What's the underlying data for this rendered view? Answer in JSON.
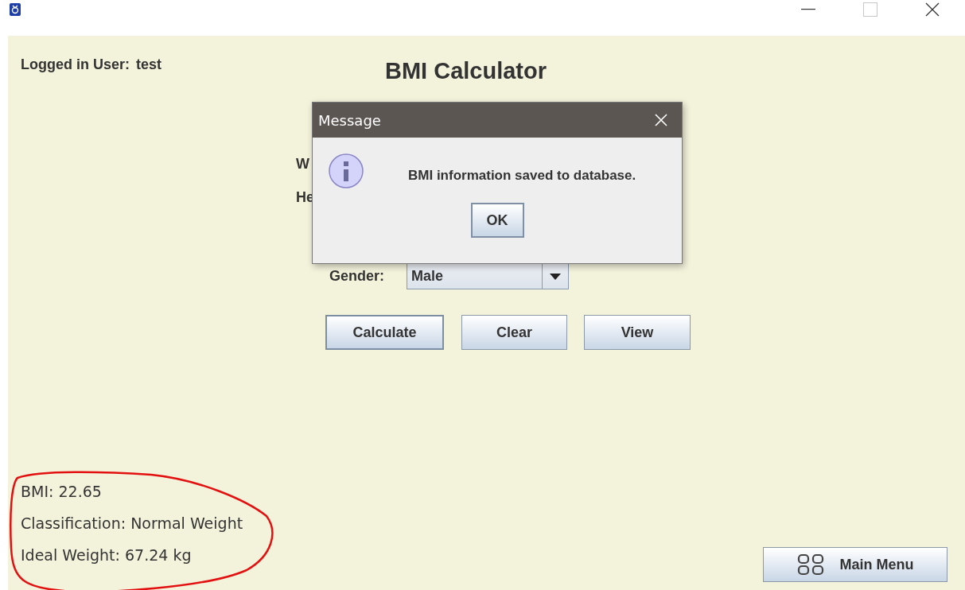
{
  "logged_in": {
    "label": "Logged in User:",
    "user": "test"
  },
  "title": "BMI Calculator",
  "form": {
    "fields": [
      {
        "label": "W"
      },
      {
        "label": "He"
      }
    ],
    "gender": {
      "label": "Gender:",
      "value": "Male"
    },
    "buttons": [
      {
        "label": "Calculate",
        "focused": true
      },
      {
        "label": "Clear",
        "focused": false
      },
      {
        "label": "View",
        "focused": false
      }
    ]
  },
  "results": [
    "BMI: 22.65",
    "Classification: Normal Weight",
    "Ideal Weight: 67.24 kg"
  ],
  "main_menu": {
    "label": "Main Menu"
  },
  "dialog": {
    "title": "Message",
    "message": "BMI information saved to database.",
    "button": "OK"
  }
}
